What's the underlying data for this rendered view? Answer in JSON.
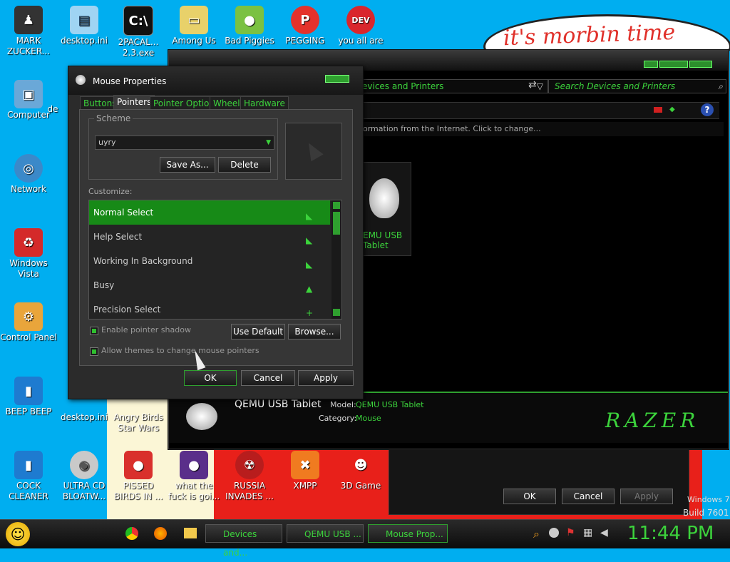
{
  "wallpaper": {
    "speech_bubble": "it's morbin time"
  },
  "desktop_icons": [
    {
      "label": "MARK ZUCKER...",
      "icon": "person-icon"
    },
    {
      "label": "desktop.ini",
      "icon": "text-file-icon"
    },
    {
      "label": "2PACAL... 2.3.exe",
      "icon": "terminal-icon"
    },
    {
      "label": "Among Us",
      "icon": "among-us-icon"
    },
    {
      "label": "Bad Piggies",
      "icon": "piggy-icon"
    },
    {
      "label": "PEGGING",
      "icon": "p-logo-icon"
    },
    {
      "label": "you all are",
      "icon": "devcpp-icon"
    },
    {
      "label": "Computer",
      "icon": "computer-icon"
    },
    {
      "label": "de",
      "icon": "file-icon"
    },
    {
      "label": "Network",
      "icon": "network-icon"
    },
    {
      "label": "Windows Vista",
      "icon": "recycle-bin-icon"
    },
    {
      "label": "Control Panel",
      "icon": "control-panel-icon"
    },
    {
      "label": "BEEP BEEP",
      "icon": "blue-book-icon"
    },
    {
      "label": "desktop.ini",
      "icon": "text-file-icon"
    },
    {
      "label": "Angry Birds Star Wars",
      "icon": "angry-birds-icon"
    },
    {
      "label": "COCK CLEANER",
      "icon": "blue-book-icon"
    },
    {
      "label": "ULTRA CD BLOATW...",
      "icon": "cd-icon"
    },
    {
      "label": "PISSED BIRDS IN ...",
      "icon": "angry-birds-icon"
    },
    {
      "label": "what the fuck is goi...",
      "icon": "angry-birds-space-icon"
    },
    {
      "label": "RUSSIA INVADES ...",
      "icon": "radiation-icon"
    },
    {
      "label": "XMPP",
      "icon": "xampp-icon"
    },
    {
      "label": "3D Game",
      "icon": "character-icon"
    }
  ],
  "explorer": {
    "address": "evices and Printers",
    "search_placeholder": "Search Devices and Printers",
    "info_bar": "ormation from the Internet. Click to change...",
    "device_label": "QEMU USB Tablet",
    "device_label_partial": "EMU USB Tablet",
    "details": {
      "name": "QEMU USB Tablet",
      "model_label": "Model:",
      "model_value": "QEMU USB Tablet",
      "category_label": "Category:",
      "category_value": "Mouse"
    },
    "brand": "RAZER"
  },
  "dialog": {
    "title": "Mouse Properties",
    "tabs": [
      "Buttons",
      "Pointers",
      "Pointer Options",
      "Wheel",
      "Hardware"
    ],
    "active_tab": "Pointers",
    "scheme_legend": "Scheme",
    "scheme_value": "uyry",
    "save_as": "Save As...",
    "delete": "Delete",
    "customize_label": "Customize:",
    "cursors": [
      {
        "label": "Normal Select",
        "selected": true
      },
      {
        "label": "Help Select",
        "selected": false
      },
      {
        "label": "Working In Background",
        "selected": false
      },
      {
        "label": "Busy",
        "selected": false
      },
      {
        "label": "Precision Select",
        "selected": false
      }
    ],
    "enable_shadow": "Enable pointer shadow",
    "allow_themes": "Allow themes to change mouse pointers",
    "use_default": "Use Default",
    "browse": "Browse...",
    "ok": "OK",
    "cancel": "Cancel",
    "apply": "Apply"
  },
  "back_dialog": {
    "ok": "OK",
    "cancel": "Cancel",
    "apply": "Apply"
  },
  "watermark": {
    "line1": "Windows 7",
    "line2": "Build 7601"
  },
  "taskbar": {
    "tasks": [
      "Devices and...",
      "QEMU USB ...",
      "Mouse Prop..."
    ],
    "clock": "11:44 PM"
  },
  "colors": {
    "accent": "#3cd33c",
    "selection": "#178a17",
    "desktop": "#00aef0"
  }
}
